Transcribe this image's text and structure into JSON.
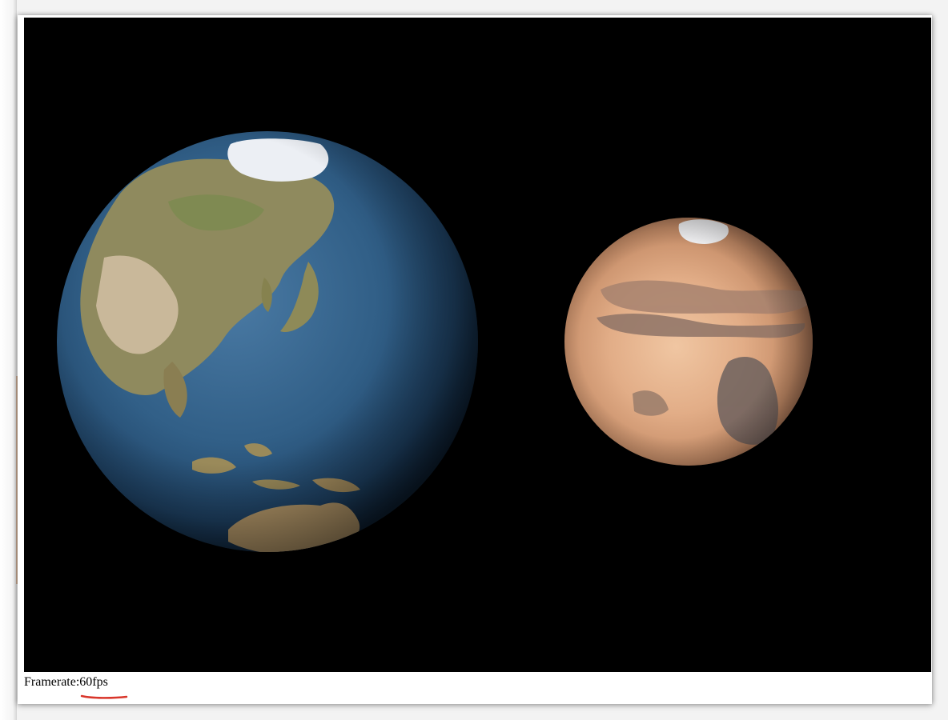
{
  "footer": {
    "framerate_label": "Framerate:",
    "framerate_value": "60fps"
  },
  "scene": {
    "background_color": "#000000",
    "bodies": [
      "earth",
      "mars"
    ]
  },
  "colors": {
    "ocean": "#2f5b82",
    "land": "#9c8a5c",
    "ice": "#eef0f4",
    "mars_surface": "#d9a07a",
    "mars_dark": "#6b5a56",
    "annotation_underline": "#d9362b"
  }
}
